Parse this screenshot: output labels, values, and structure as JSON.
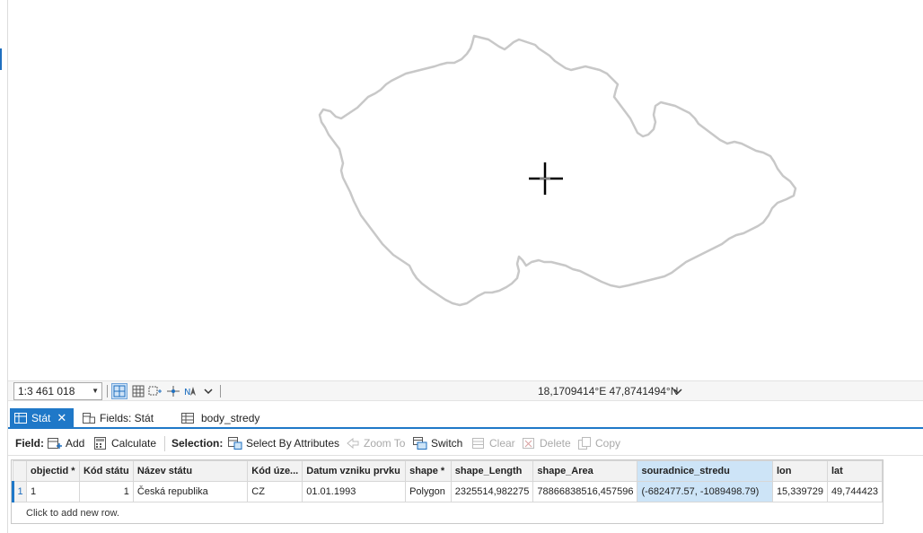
{
  "status_bar": {
    "scale": "1:3 461 018",
    "coordinates": "18,1709414°E 47,8741494°N"
  },
  "tabs": [
    {
      "label": "Stát"
    },
    {
      "label": "Fields: Stát"
    },
    {
      "label": "body_stredy"
    }
  ],
  "toolbar": {
    "field_label": "Field:",
    "add_label": "Add",
    "calculate_label": "Calculate",
    "selection_label": "Selection:",
    "select_by_attributes_label": "Select By Attributes",
    "zoom_to_label": "Zoom To",
    "switch_label": "Switch",
    "clear_label": "Clear",
    "delete_label": "Delete",
    "copy_label": "Copy"
  },
  "table": {
    "columns": [
      "objectid *",
      "Kód státu",
      "Název státu",
      "Kód úze...",
      "Datum vzniku prvku",
      "shape *",
      "shape_Length",
      "shape_Area",
      "souradnice_stredu",
      "lon",
      "lat"
    ],
    "rows": [
      {
        "row_number": "1",
        "cells": [
          "1",
          "1",
          "Česká republika",
          "CZ",
          "01.01.1993",
          "Polygon",
          "2325514,982275",
          "78866838516,457596",
          "(-682477.57, -1089498.79)",
          "15,339729",
          "49,744423"
        ]
      }
    ],
    "add_row_text": "Click to add new row."
  },
  "colors": {
    "accent": "#1f78c8",
    "selected_column": "#cde4f7",
    "outline": "#c8c8c8"
  }
}
